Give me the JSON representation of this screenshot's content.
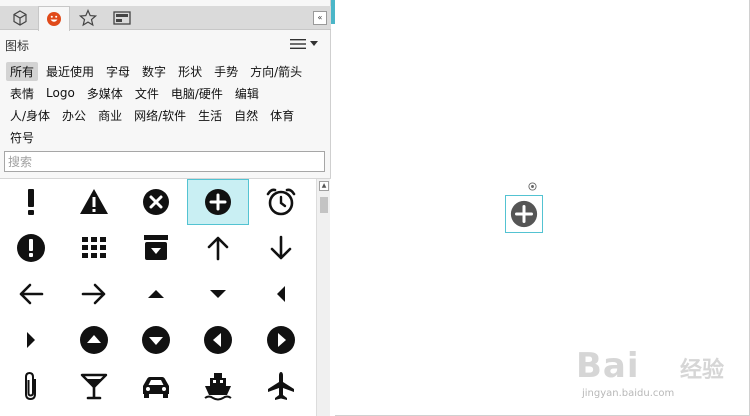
{
  "tabs": [
    {
      "icon": "cube-icon"
    },
    {
      "icon": "emoji-icon",
      "color": "#e04a1a"
    },
    {
      "icon": "star-icon"
    },
    {
      "icon": "photo-frame-icon"
    }
  ],
  "collapse_label": "«",
  "section_title": "图标",
  "categories": [
    [
      {
        "label": "所有",
        "active": true
      },
      {
        "label": "最近使用"
      },
      {
        "label": "字母"
      },
      {
        "label": "数字"
      },
      {
        "label": "形状"
      },
      {
        "label": "手势"
      },
      {
        "label": "方向/箭头"
      }
    ],
    [
      {
        "label": "表情"
      },
      {
        "label": "Logo"
      },
      {
        "label": "多媒体"
      },
      {
        "label": "文件"
      },
      {
        "label": "电脑/硬件"
      },
      {
        "label": "编辑"
      }
    ],
    [
      {
        "label": "人/身体"
      },
      {
        "label": "办公"
      },
      {
        "label": "商业"
      },
      {
        "label": "网络/软件"
      },
      {
        "label": "生活"
      },
      {
        "label": "自然"
      },
      {
        "label": "体育"
      }
    ],
    [
      {
        "label": "符号"
      }
    ]
  ],
  "search": {
    "placeholder": "搜索",
    "value": ""
  },
  "icon_rows": [
    [
      "exclamation-icon",
      "warning-triangle-icon",
      "close-circle-icon",
      "plus-circle-icon",
      "alarm-clock-icon"
    ],
    [
      "exclamation-circle-icon",
      "grid-dots-icon",
      "archive-download-icon",
      "arrow-up-icon",
      "arrow-down-icon"
    ],
    [
      "arrow-left-icon",
      "arrow-right-icon",
      "caret-up-icon",
      "caret-down-icon",
      "caret-left-icon"
    ],
    [
      "caret-right-icon",
      "chevron-up-circle-icon",
      "chevron-down-circle-icon",
      "chevron-left-circle-icon",
      "chevron-right-circle-icon"
    ],
    [
      "paperclip-icon",
      "cocktail-glass-icon",
      "car-icon",
      "ship-icon",
      "airplane-icon"
    ]
  ],
  "selected_icon": "plus-circle-icon",
  "canvas_shape": {
    "icon": "plus-circle-icon",
    "color": "#555555"
  },
  "accent_color": "#4bb6c8",
  "watermark": {
    "brand": "Bai",
    "brand_cn": "经验",
    "url": "jingyan.baidu.com"
  }
}
